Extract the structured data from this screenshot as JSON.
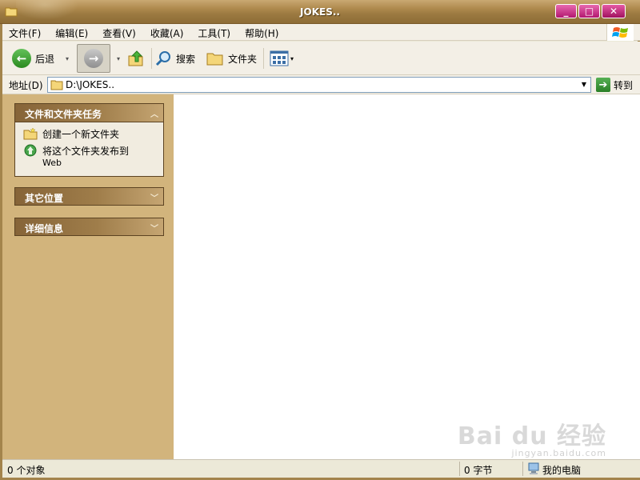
{
  "window": {
    "title": "JOKES.."
  },
  "menu": [
    "文件(F)",
    "编辑(E)",
    "查看(V)",
    "收藏(A)",
    "工具(T)",
    "帮助(H)"
  ],
  "toolbar": {
    "back_label": "后退",
    "search_label": "搜索",
    "folders_label": "文件夹"
  },
  "address": {
    "label": "地址(D)",
    "value": "D:\\JOKES..",
    "go_label": "转到"
  },
  "panels": {
    "tasks": {
      "title": "文件和文件夹任务",
      "items": [
        {
          "label": "创建一个新文件夹",
          "icon": "new-folder-icon"
        },
        {
          "label": "将这个文件夹发布到",
          "sub": "Web",
          "icon": "publish-web-icon"
        }
      ]
    },
    "other_places": {
      "title": "其它位置"
    },
    "details": {
      "title": "详细信息"
    }
  },
  "status": {
    "objects": "0 个对象",
    "size": "0 字节",
    "location": "我的电脑"
  },
  "watermark": {
    "text": "Bai du 经验",
    "sub": "jingyan.baidu.com"
  },
  "colors": {
    "titlebar": "#9c7a41",
    "sidepane": "#d2b47c",
    "close_button": "#b2176f"
  }
}
